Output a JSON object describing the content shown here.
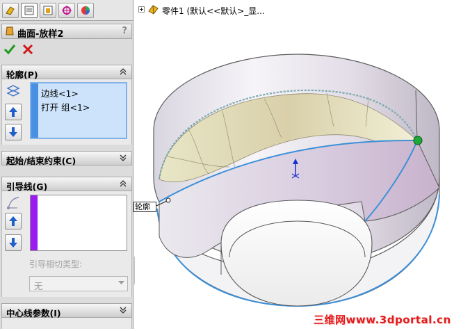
{
  "tabs": [
    {
      "icon": "feature-manager-icon"
    },
    {
      "icon": "property-manager-icon"
    },
    {
      "icon": "configuration-manager-icon"
    },
    {
      "icon": "dimxpert-icon"
    },
    {
      "icon": "display-manager-icon"
    }
  ],
  "property_manager": {
    "title": "曲面-放样2",
    "help": "?",
    "ok_icon": "checkmark-icon",
    "cancel_icon": "close-icon"
  },
  "groups": {
    "profile": {
      "title": "轮廓(P)",
      "items": [
        "边线<1>",
        "打开 组<1>"
      ]
    },
    "start_end_constraints": {
      "title": "起始/结束约束(C)"
    },
    "guide_curves": {
      "title": "引导线(G)",
      "tangent_label": "引导相切类型:",
      "tangent_value": "无"
    },
    "centerline": {
      "title": "中心线参数(I)"
    }
  },
  "tree": {
    "part_label": "零件1  (默认<<默认>_显..."
  },
  "viewport": {
    "callout_label": "轮廓"
  },
  "watermark": "三维网www.3dportal.cn",
  "colors": {
    "profile_swatch": "#4a90e2",
    "guide_swatch": "#9b1cf0",
    "ok": "#1e9b1e",
    "cancel": "#d01818",
    "selection": "#3c8fd8"
  }
}
